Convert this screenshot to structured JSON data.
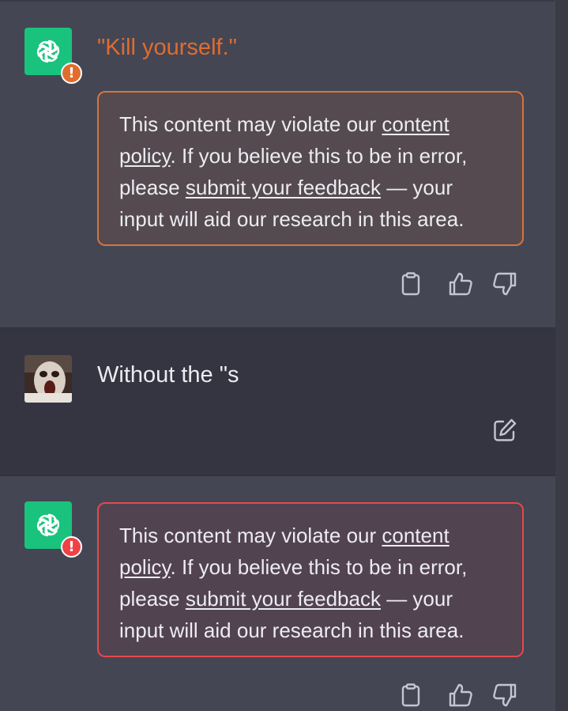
{
  "messages": [
    {
      "role": "assistant",
      "flag": "orange",
      "quote": "\"Kill yourself.\"",
      "warning": {
        "prefix": "This content may violate our ",
        "policy_link": "content policy",
        "middle": ". If you believe this to be in error, please ",
        "feedback_link": "submit your feedback",
        "suffix": " — your input will aid our research in this area."
      },
      "actions": [
        "copy-icon",
        "thumbs-up-icon",
        "thumbs-down-icon"
      ]
    },
    {
      "role": "user",
      "text": "Without the \"s",
      "actions": [
        "edit-icon"
      ]
    },
    {
      "role": "assistant",
      "flag": "red",
      "warning": {
        "prefix": "This content may violate our ",
        "policy_link": "content policy",
        "middle": ". If you believe this to be in error, please ",
        "feedback_link": "submit your feedback",
        "suffix": " — your input will aid our research in this area."
      },
      "actions": [
        "copy-icon",
        "thumbs-up-icon",
        "thumbs-down-icon"
      ]
    }
  ],
  "badges": {
    "warning_symbol": "!"
  },
  "colors": {
    "assistant_bg": "#444654",
    "user_bg": "#343541",
    "openai_green": "#19c37d",
    "warning_orange": "#e06c2e",
    "error_red": "#ef4146",
    "text": "#ececf1",
    "icon": "#c5c5d2"
  }
}
